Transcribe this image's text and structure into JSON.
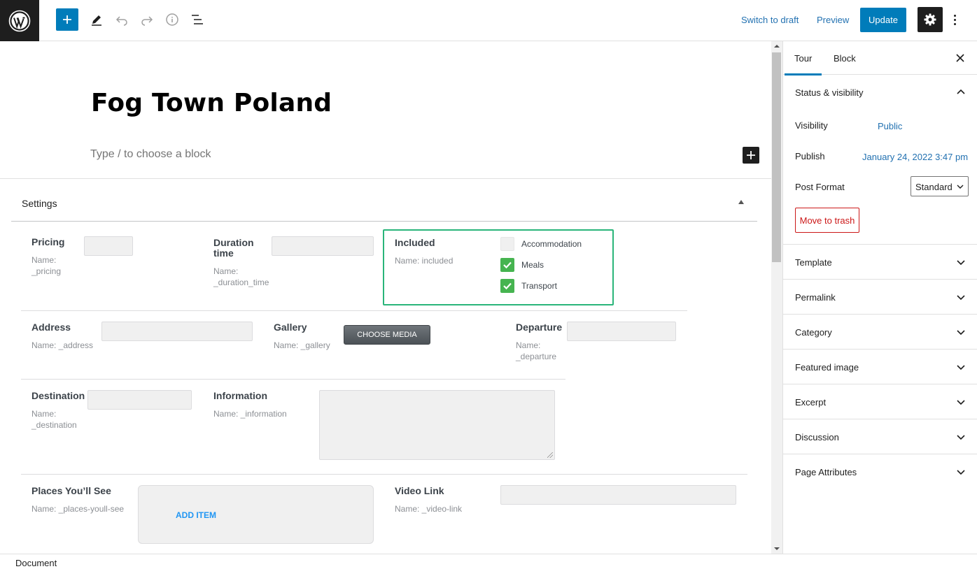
{
  "toolbar": {
    "switch_to_draft": "Switch to draft",
    "preview": "Preview",
    "update": "Update",
    "icons": [
      "wordpress-icon",
      "plus-icon",
      "pencil-icon",
      "undo-icon",
      "redo-icon",
      "info-icon",
      "list-view-icon",
      "gear-icon",
      "more-vertical-icon"
    ]
  },
  "editor": {
    "title": "Fog Town Poland",
    "block_placeholder": "Type / to choose a block"
  },
  "metabox": {
    "title": "Settings",
    "fields": {
      "pricing": {
        "label": "Pricing",
        "name_line1": "Name:",
        "name_line2": "_pricing"
      },
      "duration": {
        "label_line1": "Duration",
        "label_line2": "time",
        "name_line1": "Name:",
        "name_line2": "_duration_time"
      },
      "included": {
        "label": "Included",
        "name": "Name: included",
        "options": [
          {
            "label": "Accommodation",
            "checked": false
          },
          {
            "label": "Meals",
            "checked": true
          },
          {
            "label": "Transport",
            "checked": true
          }
        ]
      },
      "address": {
        "label": "Address",
        "name": "Name: _address"
      },
      "gallery": {
        "label": "Gallery",
        "name": "Name: _gallery",
        "button": "CHOOSE MEDIA"
      },
      "departure": {
        "label": "Departure",
        "name_line1": "Name:",
        "name_line2": "_departure"
      },
      "destination": {
        "label": "Destination",
        "name_line1": "Name:",
        "name_line2": "_destination"
      },
      "information": {
        "label": "Information",
        "name": "Name: _information"
      },
      "places": {
        "label": "Places You’ll See",
        "name": "Name: _places-youll-see",
        "add_item": "ADD ITEM"
      },
      "video": {
        "label": "Video Link",
        "name": "Name: _video-link"
      }
    }
  },
  "sidebar": {
    "tabs": [
      "Tour",
      "Block"
    ],
    "status": {
      "title": "Status & visibility",
      "visibility_label": "Visibility",
      "visibility_value": "Public",
      "publish_label": "Publish",
      "publish_value": "January 24, 2022 3:47 pm",
      "format_label": "Post Format",
      "format_value": "Standard",
      "trash": "Move to trash"
    },
    "panels": [
      "Template",
      "Permalink",
      "Category",
      "Featured image",
      "Excerpt",
      "Discussion",
      "Page Attributes"
    ]
  },
  "footer": {
    "breadcrumb": "Document"
  },
  "colors": {
    "accent": "#007cba",
    "checkbox_on": "#46b450",
    "highlight": "#2ab57a",
    "danger": "#cc1818"
  }
}
